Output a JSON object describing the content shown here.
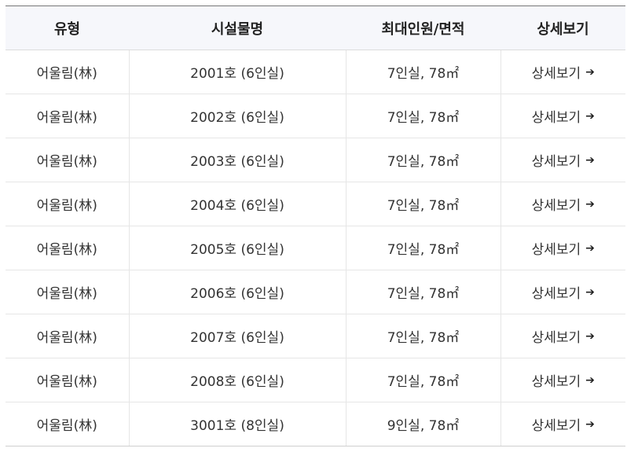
{
  "table": {
    "headers": {
      "type": "유형",
      "name": "시설물명",
      "capacity": "최대인원/면적",
      "detail": "상세보기"
    },
    "rows": [
      {
        "type": "어울림(林)",
        "name": "2001호 (6인실)",
        "capacity": "7인실, 78㎡",
        "detail": "상세보기"
      },
      {
        "type": "어울림(林)",
        "name": "2002호 (6인실)",
        "capacity": "7인실, 78㎡",
        "detail": "상세보기"
      },
      {
        "type": "어울림(林)",
        "name": "2003호 (6인실)",
        "capacity": "7인실, 78㎡",
        "detail": "상세보기"
      },
      {
        "type": "어울림(林)",
        "name": "2004호 (6인실)",
        "capacity": "7인실, 78㎡",
        "detail": "상세보기"
      },
      {
        "type": "어울림(林)",
        "name": "2005호 (6인실)",
        "capacity": "7인실, 78㎡",
        "detail": "상세보기"
      },
      {
        "type": "어울림(林)",
        "name": "2006호 (6인실)",
        "capacity": "7인실, 78㎡",
        "detail": "상세보기"
      },
      {
        "type": "어울림(林)",
        "name": "2007호 (6인실)",
        "capacity": "7인실, 78㎡",
        "detail": "상세보기"
      },
      {
        "type": "어울림(林)",
        "name": "2008호 (6인실)",
        "capacity": "7인실, 78㎡",
        "detail": "상세보기"
      },
      {
        "type": "어울림(林)",
        "name": "3001호 (8인실)",
        "capacity": "9인실, 78㎡",
        "detail": "상세보기"
      }
    ],
    "detail_arrow_icon": "arrow-right-icon"
  }
}
